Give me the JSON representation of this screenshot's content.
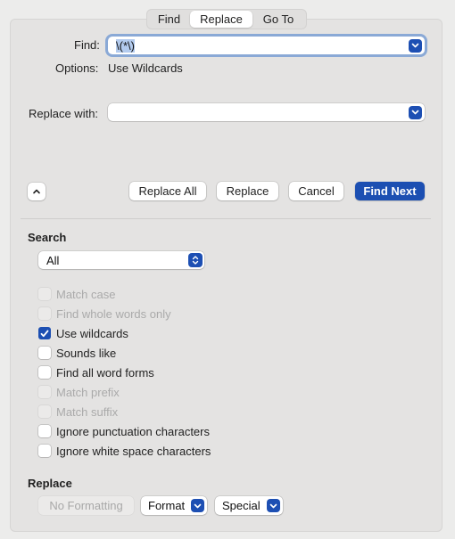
{
  "tabs": [
    {
      "label": "Find",
      "selected": false
    },
    {
      "label": "Replace",
      "selected": true
    },
    {
      "label": "Go To",
      "selected": false
    }
  ],
  "find": {
    "label": "Find:",
    "value": "\\(*\\)"
  },
  "options": {
    "label": "Options:",
    "value": "Use Wildcards"
  },
  "replace_with": {
    "label": "Replace with:",
    "value": ""
  },
  "buttons": {
    "collapse_icon": "chevron-up-icon",
    "replace_all": "Replace All",
    "replace": "Replace",
    "cancel": "Cancel",
    "find_next": "Find Next"
  },
  "search": {
    "title": "Search",
    "scope_selected": "All"
  },
  "checkboxes": [
    {
      "label": "Match case",
      "checked": false,
      "enabled": false
    },
    {
      "label": "Find whole words only",
      "checked": false,
      "enabled": false
    },
    {
      "label": "Use wildcards",
      "checked": true,
      "enabled": true
    },
    {
      "label": "Sounds like",
      "checked": false,
      "enabled": true
    },
    {
      "label": "Find all word forms",
      "checked": false,
      "enabled": true
    },
    {
      "label": "Match prefix",
      "checked": false,
      "enabled": false
    },
    {
      "label": "Match suffix",
      "checked": false,
      "enabled": false
    },
    {
      "label": "Ignore punctuation characters",
      "checked": false,
      "enabled": true
    },
    {
      "label": "Ignore white space characters",
      "checked": false,
      "enabled": true
    }
  ],
  "replace_section": {
    "title": "Replace",
    "no_formatting": "No Formatting",
    "format": "Format",
    "special": "Special"
  },
  "colors": {
    "accent": "#1c4fb2",
    "panel_bg": "#e4e3e2",
    "window_bg": "#ececeb",
    "focus_ring": "#8aa9d6"
  }
}
